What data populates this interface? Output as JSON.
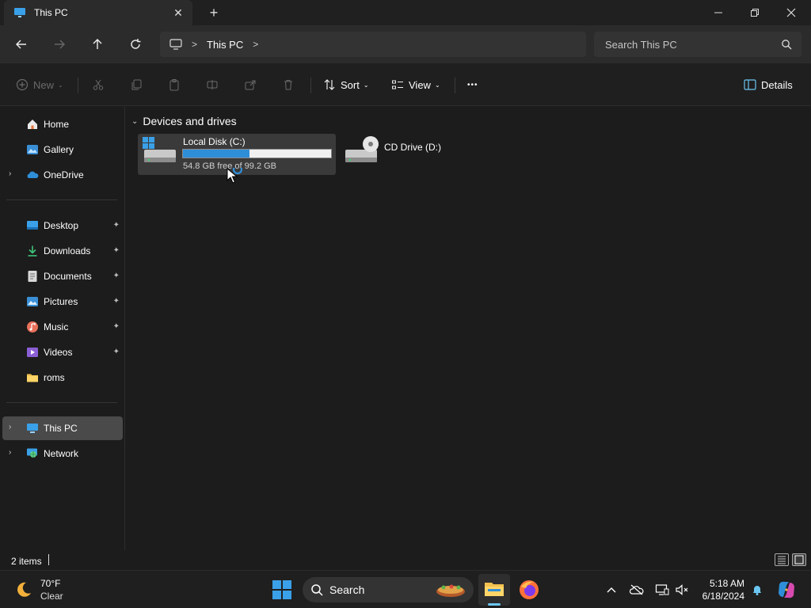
{
  "window": {
    "tab_title": "This PC",
    "tab_close_glyph": "✕",
    "new_tab_glyph": "+",
    "icons": [
      "this-pc-icon",
      "close-icon",
      "plus-icon",
      "minimize-icon",
      "restore-icon",
      "close-window-icon"
    ]
  },
  "address": {
    "crumbs": [
      "This PC"
    ],
    "search_placeholder": "Search This PC"
  },
  "commands": {
    "new_label": "New",
    "sort_label": "Sort",
    "view_label": "View",
    "more_glyph": "•••",
    "details_label": "Details"
  },
  "sidebar": {
    "items": [
      {
        "label": "Home",
        "icon": "home-icon"
      },
      {
        "label": "Gallery",
        "icon": "gallery-icon"
      },
      {
        "label": "OneDrive",
        "icon": "onedrive-icon"
      },
      {
        "label": "Desktop",
        "icon": "desktop-icon",
        "pinned": true
      },
      {
        "label": "Downloads",
        "icon": "download-icon",
        "pinned": true
      },
      {
        "label": "Documents",
        "icon": "documents-icon",
        "pinned": true
      },
      {
        "label": "Pictures",
        "icon": "pictures-icon",
        "pinned": true
      },
      {
        "label": "Music",
        "icon": "music-icon",
        "pinned": true
      },
      {
        "label": "Videos",
        "icon": "videos-icon",
        "pinned": true
      },
      {
        "label": "roms",
        "icon": "folder-icon"
      },
      {
        "label": "This PC",
        "icon": "this-pc-icon",
        "selected": true
      },
      {
        "label": "Network",
        "icon": "network-icon"
      }
    ],
    "expander_glyph": "›",
    "pin_glyph": "📌"
  },
  "content": {
    "group_title": "Devices and drives",
    "group_chevron": "⌄",
    "drives": [
      {
        "name": "Local Disk (C:)",
        "free_text": "54.8 GB free of 99.2 GB",
        "used_fraction": 0.448,
        "icon": "windows-drive-icon"
      },
      {
        "name": "CD Drive (D:)",
        "icon": "cd-drive-icon"
      }
    ]
  },
  "status": {
    "item_count": "2 items"
  },
  "taskbar": {
    "weather_temp": "70°F",
    "weather_cond": "Clear",
    "search_label": "Search",
    "time": "5:18 AM",
    "date": "6/18/2024"
  },
  "colors": {
    "accent": "#2f8ed8",
    "folder": "#f2c14e"
  }
}
